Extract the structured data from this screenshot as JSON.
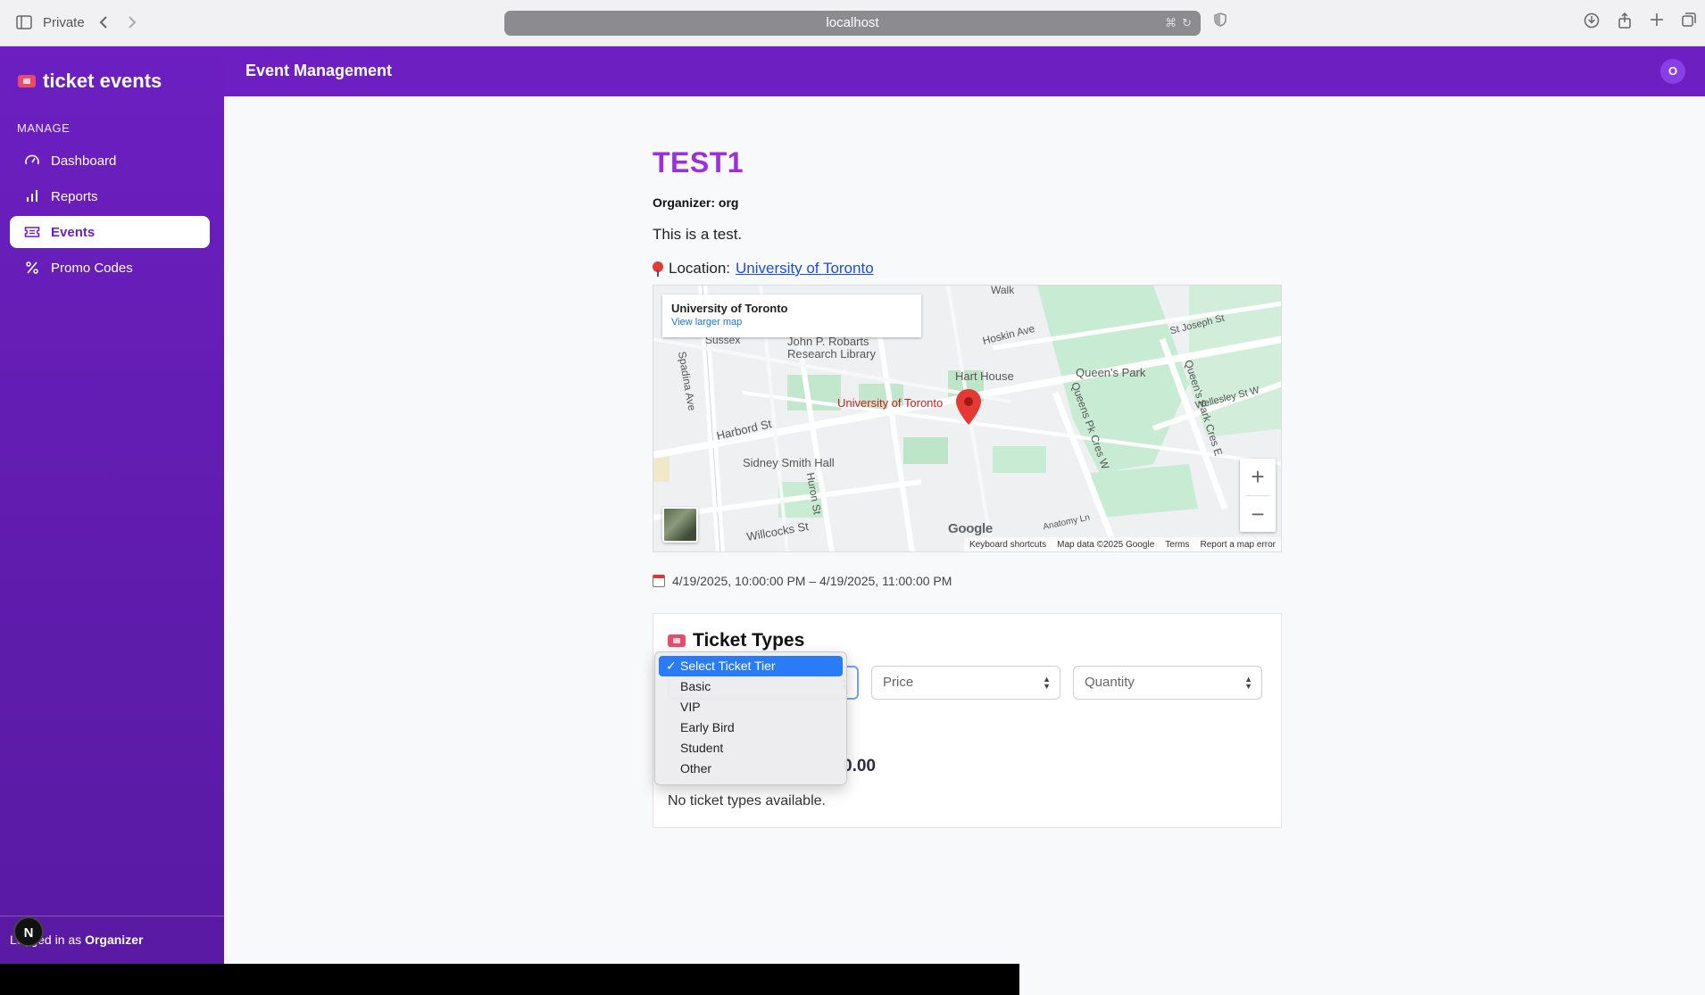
{
  "browser": {
    "private_label": "Private",
    "url": "localhost"
  },
  "sidebar": {
    "brand": "ticket events",
    "section_label": "MANAGE",
    "items": [
      {
        "label": "Dashboard",
        "icon": "gauge-icon"
      },
      {
        "label": "Reports",
        "icon": "bar-chart-icon"
      },
      {
        "label": "Events",
        "icon": "ticket-icon",
        "active": true
      },
      {
        "label": "Promo Codes",
        "icon": "percent-icon"
      }
    ],
    "footer_prefix": "Logged in as",
    "footer_role": "Organizer",
    "n_badge": "N"
  },
  "header": {
    "title": "Event Management",
    "avatar_initial": "O"
  },
  "event": {
    "title": "TEST1",
    "organizer": "Organizer: org",
    "description": "This is a test.",
    "location_prefix": "Location:",
    "location_link": "University of Toronto",
    "date_range": "4/19/2025, 10:00:00 PM – 4/19/2025, 11:00:00 PM"
  },
  "map": {
    "card_title": "University of Toronto",
    "card_link": "View larger map",
    "labels": [
      "John P. Robarts Research Library",
      "Hart House",
      "Queen's Park",
      "St Joseph St",
      "Wellesley St W",
      "Harbord St",
      "Sidney Smith Hall",
      "Huron St",
      "Spadina Ave",
      "Queens Pk Cres W",
      "Queen's Park Cres E",
      "Willcocks St",
      "Hoskin Ave",
      "University of Toronto",
      "Walk",
      "Sussex",
      "Anatomy Ln"
    ],
    "footer": [
      "Keyboard shortcuts",
      "Map data ©2025 Google",
      "Terms",
      "Report a map error"
    ],
    "google_logo": "Google"
  },
  "tickets": {
    "title": "Ticket Types",
    "select_options": [
      "Select Ticket Tier",
      "Basic",
      "VIP",
      "Early Bird",
      "Student",
      "Other"
    ],
    "selected_option": "Select Ticket Tier",
    "price_placeholder": "Price",
    "quantity_placeholder": "Quantity",
    "total_partial": "0.00",
    "empty_text": "No ticket types available."
  },
  "colors": {
    "brand_purple": "#6d1fc1",
    "title_purple": "#9b2fe0",
    "select_highlight": "#2a7cf6"
  }
}
